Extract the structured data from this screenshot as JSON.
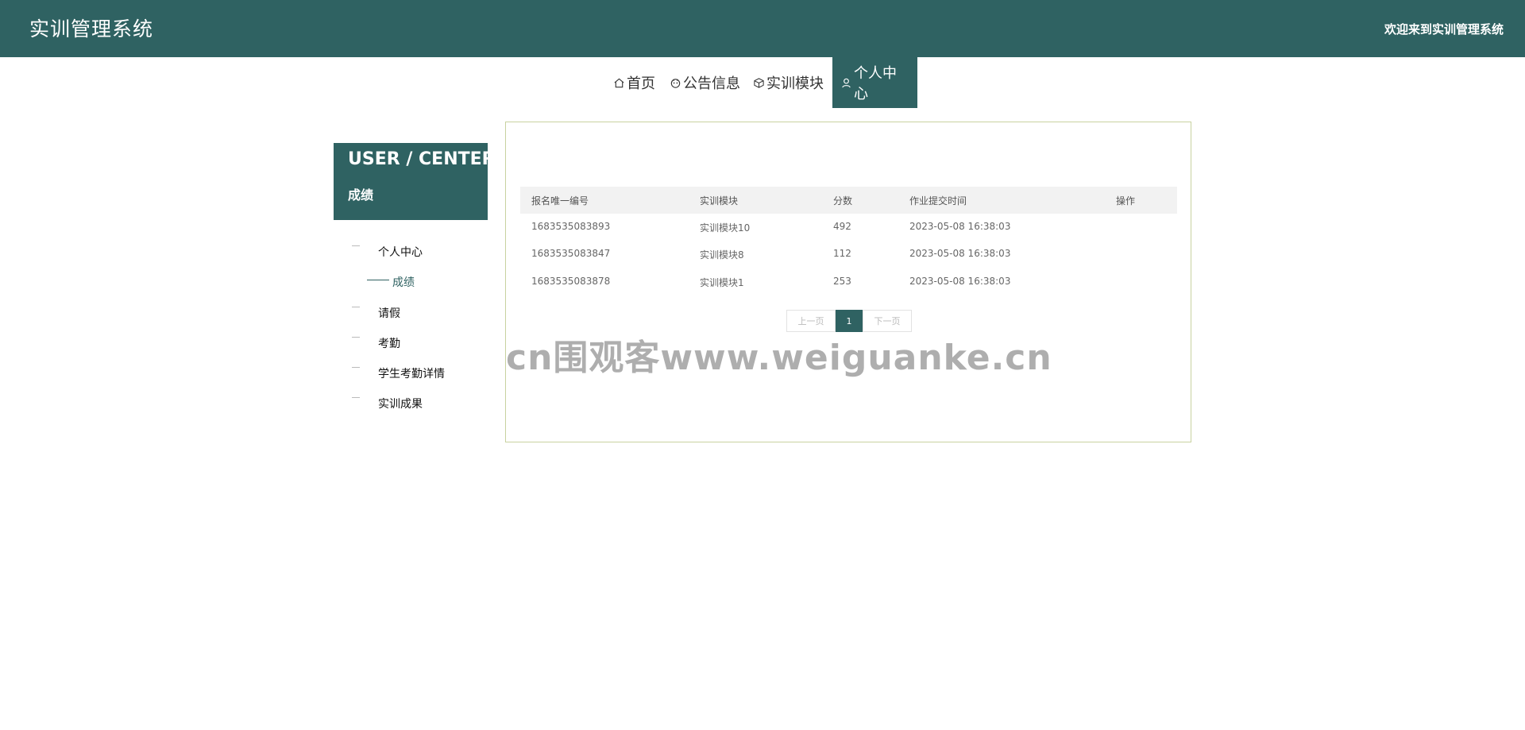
{
  "header": {
    "title": "实训管理系统",
    "welcome": "欢迎来到实训管理系统"
  },
  "nav": {
    "items": [
      {
        "label": "首页",
        "icon": "home-icon"
      },
      {
        "label": "公告信息",
        "icon": "notice-icon"
      },
      {
        "label": "实训模块",
        "icon": "box-icon"
      },
      {
        "label": "个人中心",
        "icon": "user-icon"
      }
    ],
    "active": "个人中心"
  },
  "sidebar": {
    "title": "USER / CENTER",
    "subtitle": "成绩",
    "items": [
      {
        "label": "个人中心"
      },
      {
        "label": "成绩"
      },
      {
        "label": "请假"
      },
      {
        "label": "考勤"
      },
      {
        "label": "学生考勤详情"
      },
      {
        "label": "实训成果"
      }
    ],
    "active": "成绩"
  },
  "table": {
    "columns": [
      "报名唯一编号",
      "实训模块",
      "分数",
      "作业提交时间",
      "操作"
    ],
    "rows": [
      {
        "id": "1683535083893",
        "module": "实训模块10",
        "score": "492",
        "time": "2023-05-08 16:38:03"
      },
      {
        "id": "1683535083847",
        "module": "实训模块8",
        "score": "112",
        "time": "2023-05-08 16:38:03"
      },
      {
        "id": "1683535083878",
        "module": "实训模块1",
        "score": "253",
        "time": "2023-05-08 16:38:03"
      }
    ]
  },
  "pagination": {
    "prev": "上一页",
    "current": "1",
    "next": "下一页"
  },
  "watermark": "cn围观客www.weiguanke.cn",
  "colors": {
    "primary": "#2f6262",
    "panel_border": "#c8d2a0",
    "table_header_bg": "#f2f2f2"
  }
}
